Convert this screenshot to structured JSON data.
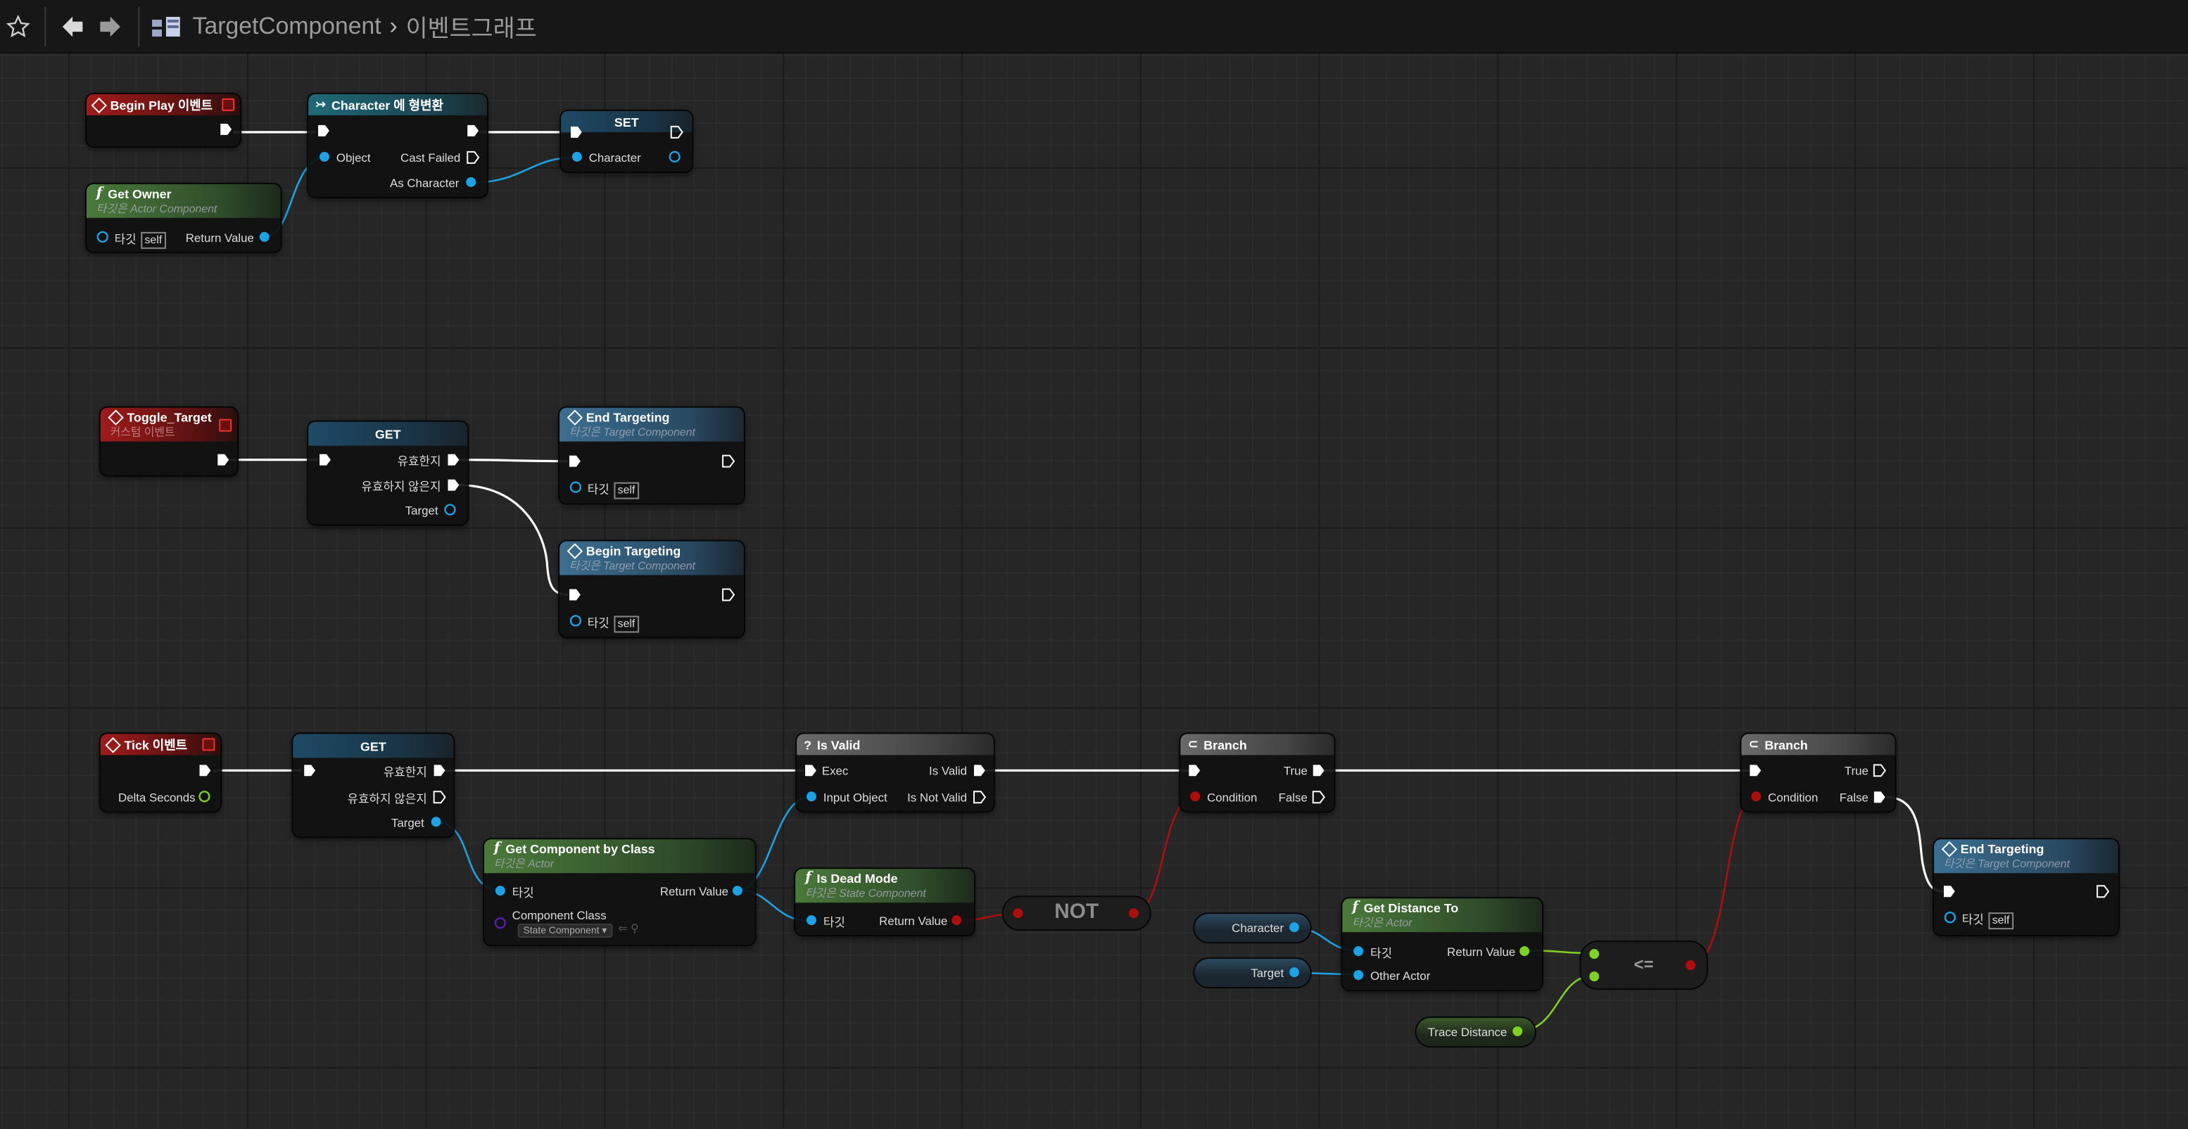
{
  "toolbar": {
    "icons": [
      "star-icon",
      "back-arrow-icon",
      "forward-arrow-icon",
      "blueprint-graph-icon"
    ],
    "breadcrumb_root": "TargetComponent",
    "breadcrumb_separator": "›",
    "breadcrumb_current": "이벤트그래프"
  },
  "colors": {
    "exec_wire": "#ffffff",
    "object_pin": "#1aa3e6",
    "bool_pin": "#b00d0d",
    "float_pin": "#7ed321",
    "class_pin": "#5c1bb3",
    "event_header": "#a11b1b",
    "pure_function_header": "#4a7a3a",
    "function_header": "#3c6f92"
  },
  "graph": {
    "begin_play": {
      "title": "Begin Play 이벤트"
    },
    "cast": {
      "title": "Character 에 형변환",
      "object": "Object",
      "cast_failed": "Cast Failed",
      "as_character": "As Character"
    },
    "set": {
      "title": "SET",
      "character": "Character"
    },
    "get_owner": {
      "title": "Get Owner",
      "subtitle": "타깃은 Actor Component",
      "target": "타깃",
      "self": "self",
      "return": "Return Value"
    },
    "toggle_target": {
      "title": "Toggle_Target",
      "subtitle": "커스텀 이벤트"
    },
    "get1": {
      "title": "GET",
      "valid": "유효한지",
      "not_valid": "유효하지 않은지",
      "target": "Target"
    },
    "end_targeting1": {
      "title": "End Targeting",
      "subtitle": "타깃은 Target Component",
      "target": "타깃",
      "self": "self"
    },
    "begin_targeting": {
      "title": "Begin Targeting",
      "subtitle": "타깃은 Target Component",
      "target": "타깃",
      "self": "self"
    },
    "tick": {
      "title": "Tick 이벤트",
      "delta": "Delta Seconds"
    },
    "get2": {
      "title": "GET",
      "valid": "유효한지",
      "not_valid": "유효하지 않은지",
      "target": "Target"
    },
    "get_component": {
      "title": "Get Component by Class",
      "subtitle": "타깃은 Actor",
      "target": "타깃",
      "return": "Return Value",
      "class_label": "Component Class",
      "class_value": "State Component"
    },
    "is_valid": {
      "title": "Is Valid",
      "exec": "Exec",
      "is_valid": "Is Valid",
      "input": "Input Object",
      "is_not_valid": "Is Not Valid"
    },
    "is_dead": {
      "title": "Is Dead Mode",
      "subtitle": "타깃은 State Component",
      "target": "타깃",
      "return": "Return Value"
    },
    "not": {
      "label": "NOT"
    },
    "branch1": {
      "title": "Branch",
      "condition": "Condition",
      "true": "True",
      "false": "False"
    },
    "character_var": {
      "label": "Character"
    },
    "target_var": {
      "label": "Target"
    },
    "get_distance": {
      "title": "Get Distance To",
      "subtitle": "타깃은 Actor",
      "target": "타깃",
      "other": "Other Actor",
      "return": "Return Value"
    },
    "trace_distance": {
      "label": "Trace Distance"
    },
    "lte": {
      "label": "<="
    },
    "branch2": {
      "title": "Branch",
      "condition": "Condition",
      "true": "True",
      "false": "False"
    },
    "end_targeting2": {
      "title": "End Targeting",
      "subtitle": "타깃은 Target Component",
      "target": "타깃",
      "self": "self"
    }
  }
}
